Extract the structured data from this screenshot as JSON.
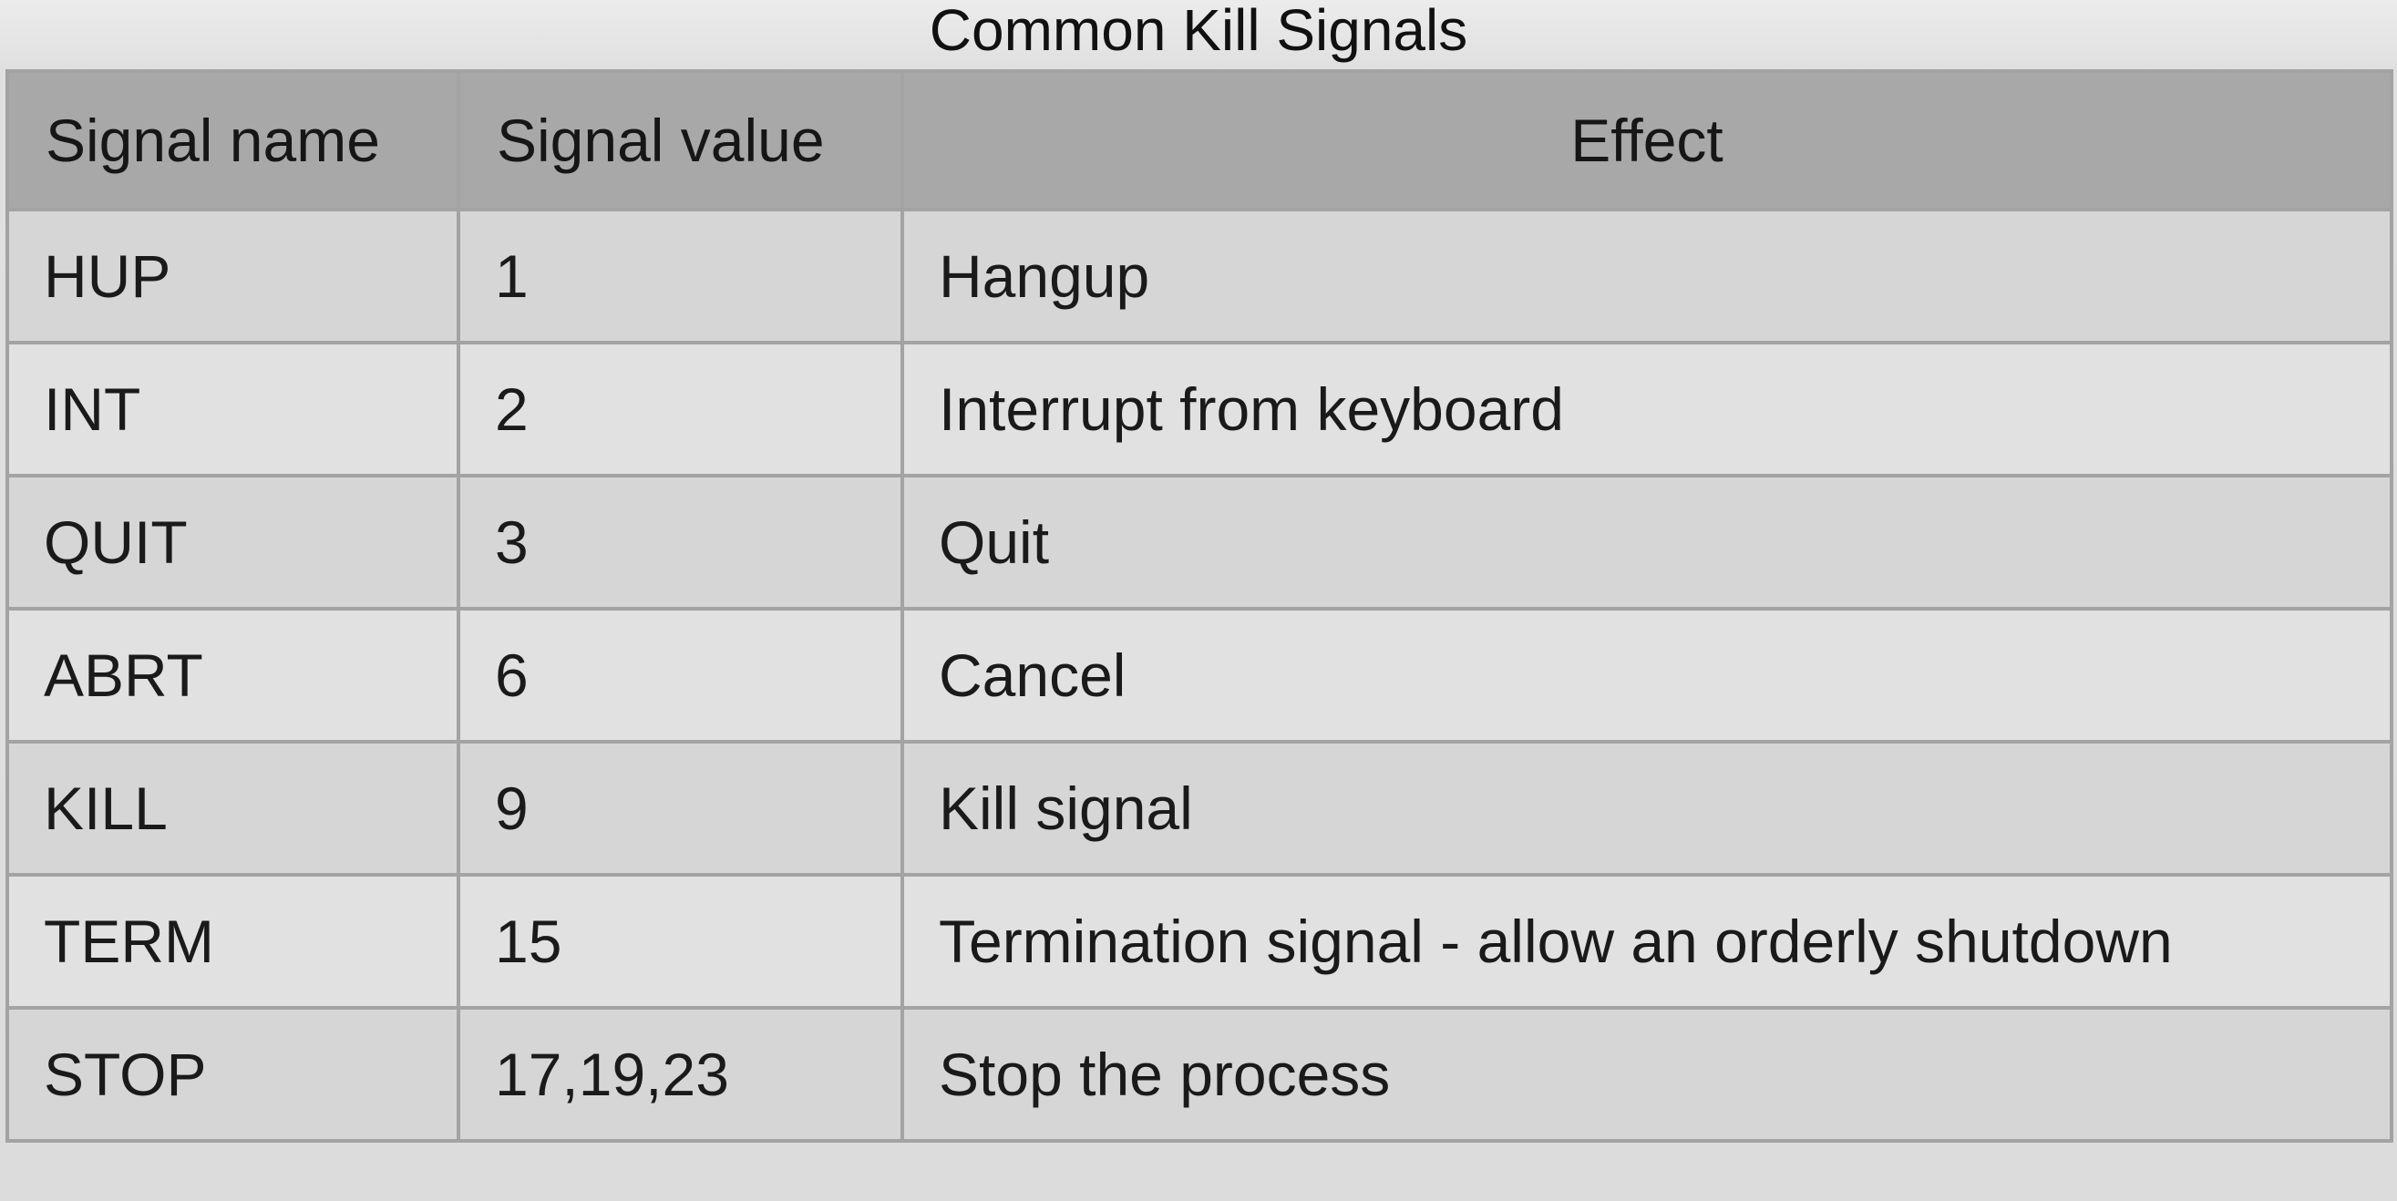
{
  "caption": "Common Kill Signals",
  "columns": [
    "Signal name",
    "Signal value",
    "Effect"
  ],
  "rows": [
    {
      "name": "HUP",
      "value": "1",
      "effect": "Hangup"
    },
    {
      "name": "INT",
      "value": "2",
      "effect": "Interrupt from keyboard"
    },
    {
      "name": "QUIT",
      "value": "3",
      "effect": "Quit"
    },
    {
      "name": "ABRT",
      "value": "6",
      "effect": "Cancel"
    },
    {
      "name": "KILL",
      "value": "9",
      "effect": "Kill signal"
    },
    {
      "name": "TERM",
      "value": "15",
      "effect": "Termination signal - allow an orderly shutdown"
    },
    {
      "name": "STOP",
      "value": "17,19,23",
      "effect": "Stop the process"
    }
  ],
  "colors": {
    "header_bg": "#a8a8a8",
    "row_odd_bg": "#d6d6d6",
    "row_even_bg": "#e1e1e1",
    "border": "#a3a3a3"
  }
}
